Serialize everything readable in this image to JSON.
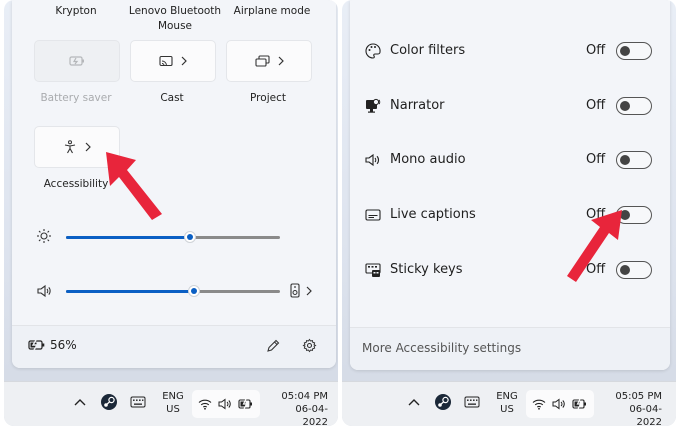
{
  "left": {
    "top_captions": [
      "Krypton",
      "Lenovo Bluetooth Mouse",
      "Airplane mode"
    ],
    "tiles": [
      {
        "label": "Battery saver",
        "disabled": true
      },
      {
        "label": "Cast",
        "disabled": false
      },
      {
        "label": "Project",
        "disabled": false
      },
      {
        "label": "Accessibility",
        "disabled": false
      }
    ],
    "brightness_level": 0.58,
    "volume_level": 0.6,
    "battery_percent": "56%",
    "taskbar": {
      "lang_line1": "ENG",
      "lang_line2": "US",
      "time": "05:04 PM",
      "date": "06-04-2022"
    }
  },
  "right": {
    "accessibility_items": [
      {
        "label": "Color filters",
        "state": "Off"
      },
      {
        "label": "Narrator",
        "state": "Off"
      },
      {
        "label": "Mono audio",
        "state": "Off"
      },
      {
        "label": "Live captions",
        "state": "Off"
      },
      {
        "label": "Sticky keys",
        "state": "Off"
      }
    ],
    "more_settings": "More Accessibility settings",
    "taskbar": {
      "lang_line1": "ENG",
      "lang_line2": "US",
      "time": "05:05 PM",
      "date": "06-04-2022"
    }
  },
  "colors": {
    "accent": "#0a5fc4",
    "annotation_arrow": "#e8253b"
  }
}
